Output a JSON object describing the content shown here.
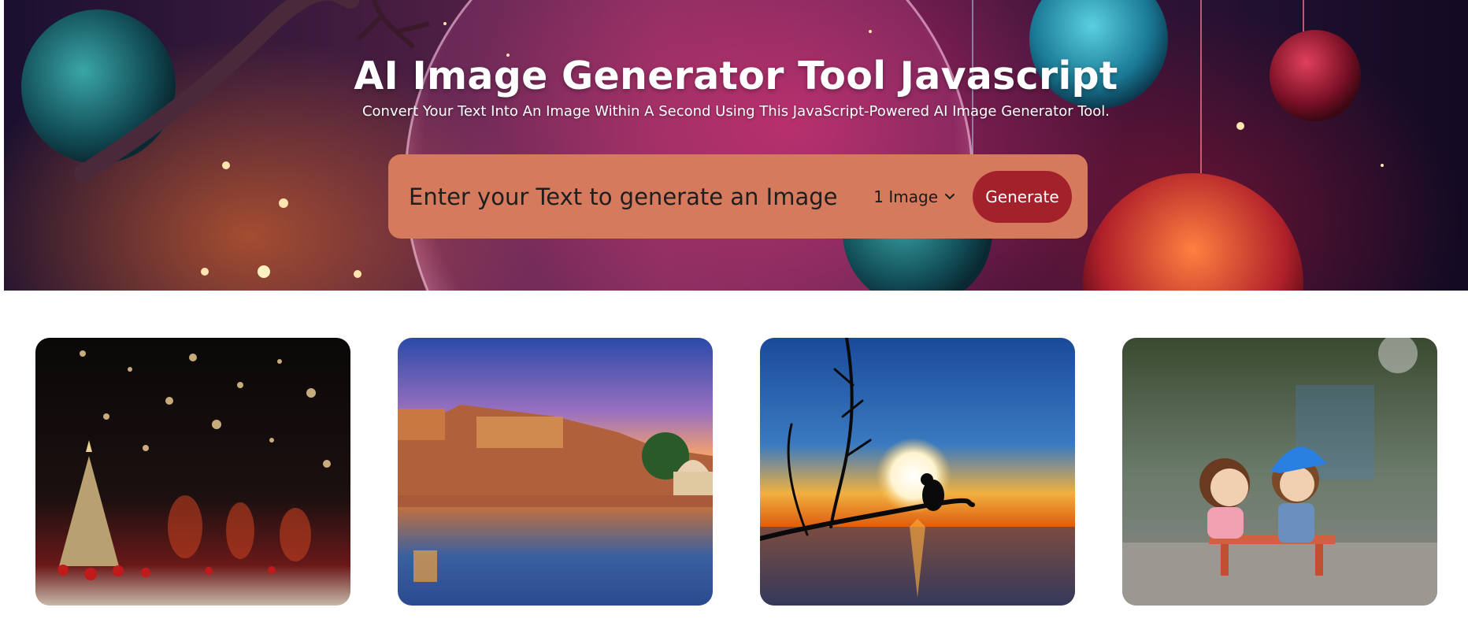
{
  "header": {
    "title": "AI Image Generator Tool Javascript",
    "subtitle": "Convert Your Text Into An Image Within A Second Using This JavaScript-Powered AI Image Generator Tool."
  },
  "form": {
    "prompt_placeholder": "Enter your Text to generate an Image",
    "prompt_value": "",
    "image_count_selected": "1 Image",
    "generate_label": "Generate"
  },
  "colors": {
    "form_background": "#d67a5e",
    "generate_button": "#a3212a",
    "title_text": "#ffffff"
  },
  "gallery": {
    "images": [
      {
        "subject": "christmas-tree-bokeh"
      },
      {
        "subject": "palace-lake-sunset"
      },
      {
        "subject": "bird-branch-sunset"
      },
      {
        "subject": "toy-couple-on-bench"
      }
    ]
  }
}
